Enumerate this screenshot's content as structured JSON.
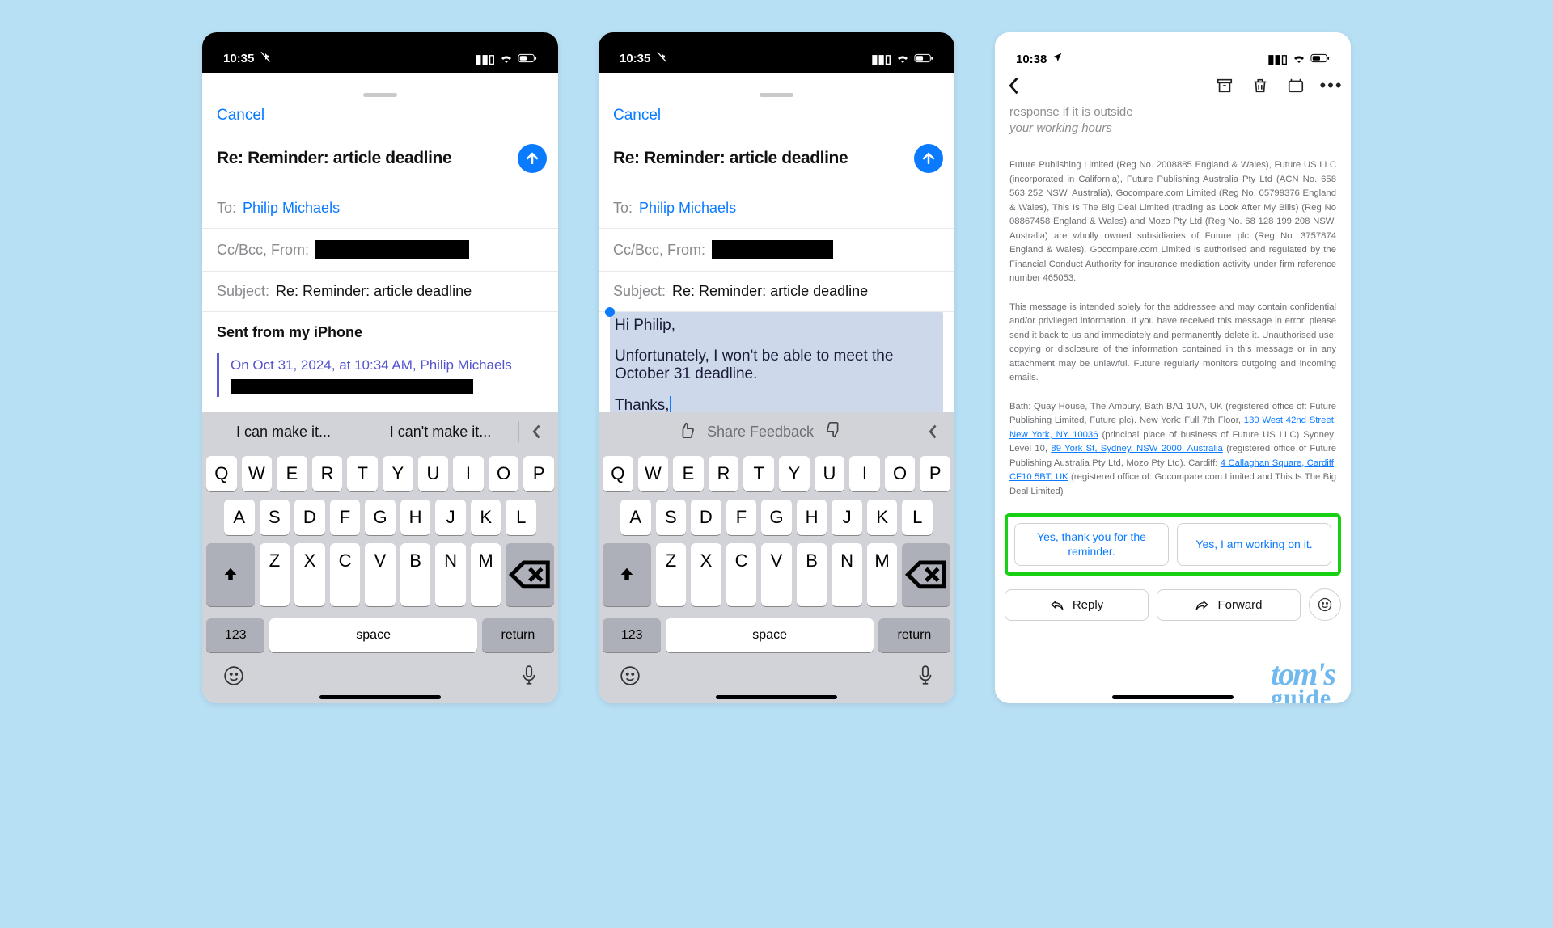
{
  "phone1": {
    "time": "10:35",
    "cancel": "Cancel",
    "subject": "Re: Reminder: article deadline",
    "to_label": "To:",
    "to_value": "Philip Michaels",
    "ccbcc_label": "Cc/Bcc, From:",
    "subject_label": "Subject:",
    "subject_value": "Re: Reminder: article deadline",
    "body_signature": "Sent from my iPhone",
    "quote_meta": "On Oct 31, 2024, at 10:34 AM, Philip Michaels",
    "suggestions": [
      "I can make it...",
      "I can't make it..."
    ],
    "kb_rows": [
      [
        "Q",
        "W",
        "E",
        "R",
        "T",
        "Y",
        "U",
        "I",
        "O",
        "P"
      ],
      [
        "A",
        "S",
        "D",
        "F",
        "G",
        "H",
        "J",
        "K",
        "L"
      ],
      [
        "Z",
        "X",
        "C",
        "V",
        "B",
        "N",
        "M"
      ]
    ],
    "kb_123": "123",
    "kb_space": "space",
    "kb_return": "return"
  },
  "phone2": {
    "time": "10:35",
    "cancel": "Cancel",
    "subject": "Re: Reminder: article deadline",
    "to_label": "To:",
    "to_value": "Philip Michaels",
    "ccbcc_label": "Cc/Bcc, From:",
    "subject_label": "Subject:",
    "subject_value": "Re: Reminder: article deadline",
    "body_lines": [
      "Hi Philip,",
      "",
      "Unfortunately, I won't be able to meet the October 31 deadline.",
      "",
      "Thanks,"
    ],
    "feedback": "Share Feedback",
    "kb_rows": [
      [
        "Q",
        "W",
        "E",
        "R",
        "T",
        "Y",
        "U",
        "I",
        "O",
        "P"
      ],
      [
        "A",
        "S",
        "D",
        "F",
        "G",
        "H",
        "J",
        "K",
        "L"
      ],
      [
        "Z",
        "X",
        "C",
        "V",
        "B",
        "N",
        "M"
      ]
    ],
    "kb_123": "123",
    "kb_space": "space",
    "kb_return": "return"
  },
  "phone3": {
    "time": "10:38",
    "faded_lines": "At Future we work flexibly and across multiple time zones, so while it may suit me to email you now, I do not expect a response if it is outside",
    "faded_last": "your working hours",
    "legal1": "Future Publishing Limited (Reg No. 2008885 England & Wales), Future US LLC (incorporated in California), Future Publishing Australia Pty Ltd (ACN No. 658 563 252 NSW, Australia), Gocompare.com Limited (Reg No. 05799376 England & Wales), This Is The Big Deal Limited (trading as Look After My Bills) (Reg No 08867458 England & Wales) and Mozo Pty Ltd (Reg No. 68 128 199 208 NSW, Australia) are wholly owned subsidiaries of Future plc (Reg No. 3757874 England & Wales). Gocompare.com Limited is authorised and regulated by the Financial Conduct Authority for insurance mediation activity under firm reference number 465053.",
    "legal2": "This message is intended solely for the addressee and may contain confidential and/or privileged information. If you have received this message in error, please send it back to us and immediately and permanently delete it. Unauthorised use, copying or disclosure of the information contained in this message or in any attachment may be unlawful. Future regularly monitors outgoing and incoming emails.",
    "addr_pre": "Bath: Quay House, The Ambury, Bath BA1 1UA, UK (registered office of: Future Publishing Limited, Future plc).  New York: Full 7th Floor, ",
    "addr_link1": "130 West 42nd Street, New York, NY 10036",
    "addr_mid1": " (principal place of business of Future US LLC) Sydney: Level 10, ",
    "addr_link2": "89 York St,  Sydney, NSW 2000, Australia",
    "addr_mid2": " (registered office of Future Publishing Australia Pty Ltd, Mozo Pty Ltd). Cardiff: ",
    "addr_link3": "4 Callaghan Square, Cardiff, CF10 5BT, UK",
    "addr_mid3": " (registered office of: Gocompare.com Limited and This Is The Big Deal Limited)",
    "smart": [
      "Yes, thank you for the reminder.",
      "Yes, I am working on it."
    ],
    "reply": "Reply",
    "forward": "Forward"
  },
  "watermark": {
    "line1": "tom's",
    "line2": "guide"
  }
}
